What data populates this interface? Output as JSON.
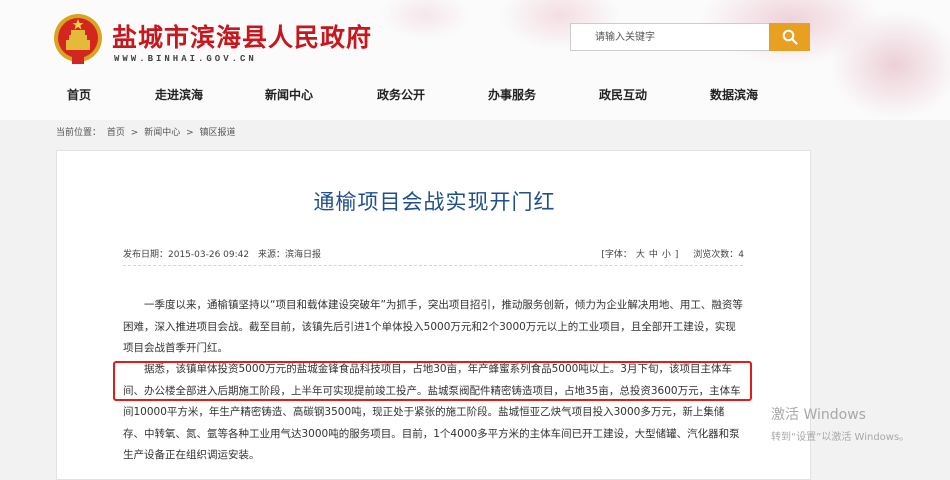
{
  "header": {
    "title": "盐城市滨海县人民政府",
    "url": "WWW.BINHAI.GOV.CN",
    "logo_icon": "national-emblem",
    "search": {
      "placeholder": "请输入关键字",
      "button_icon": "search-icon"
    }
  },
  "nav": {
    "items": [
      {
        "label": "首页"
      },
      {
        "label": "走进滨海"
      },
      {
        "label": "新闻中心"
      },
      {
        "label": "政务公开"
      },
      {
        "label": "办事服务"
      },
      {
        "label": "政民互动"
      },
      {
        "label": "数据滨海"
      }
    ]
  },
  "breadcrumb": {
    "prefix": "当前位置：",
    "items": [
      "首页",
      "新闻中心",
      "镇区报道"
    ],
    "separator": ">"
  },
  "article": {
    "title": "通榆项目会战实现开门红",
    "meta": {
      "date": "发布日期：2015-03-26 09:42",
      "source": "来源：滨海日报",
      "font_label": "[字体：",
      "font_sizes": [
        "大",
        "中",
        "小"
      ],
      "font_close": "]",
      "views": "浏览次数：4"
    },
    "paragraphs": [
      "一季度以来，通榆镇坚持以“项目和载体建设突破年”为抓手，突出项目招引，推动服务创新，倾力为企业解决用地、用工、融资等困难，深入推进项目会战。截至目前，该镇先后引进1个单体投入5000万元和2个3000万元以上的工业项目，且全部开工建设，实现项目会战首季开门红。",
      "据悉，该镇单体投资5000万元的盐城金锋食品科技项目，占地30亩，年产蜂蜜系列食品5000吨以上。3月下旬，该项目主体车间、办公楼全部进入后期施工阶段，上半年可实现提前竣工投产。盐城泵阀配件精密铸造项目，占地35亩，总投资3600万元，主体车间10000平方米，年生产精密铸造、高碳钢3500吨，现正处于紧张的施工阶段。盐城恒亚乙炔气项目投入3000多万元，新上集储存、中转氧、氮、氩等各种工业用气达3000吨的服务项目。目前，1个4000多平方米的主体车间已开工建设，大型储罐、汽化器和泵生产设备正在组织调运安装。"
    ]
  },
  "watermark": {
    "line1": "激活 Windows",
    "line2": "转到“设置”以激活 Windows。"
  },
  "colors": {
    "brand_red": "#c8161d",
    "title_blue": "#1f4f8c",
    "search_orange": "#e8a020",
    "highlight_red": "#e01d1d"
  }
}
